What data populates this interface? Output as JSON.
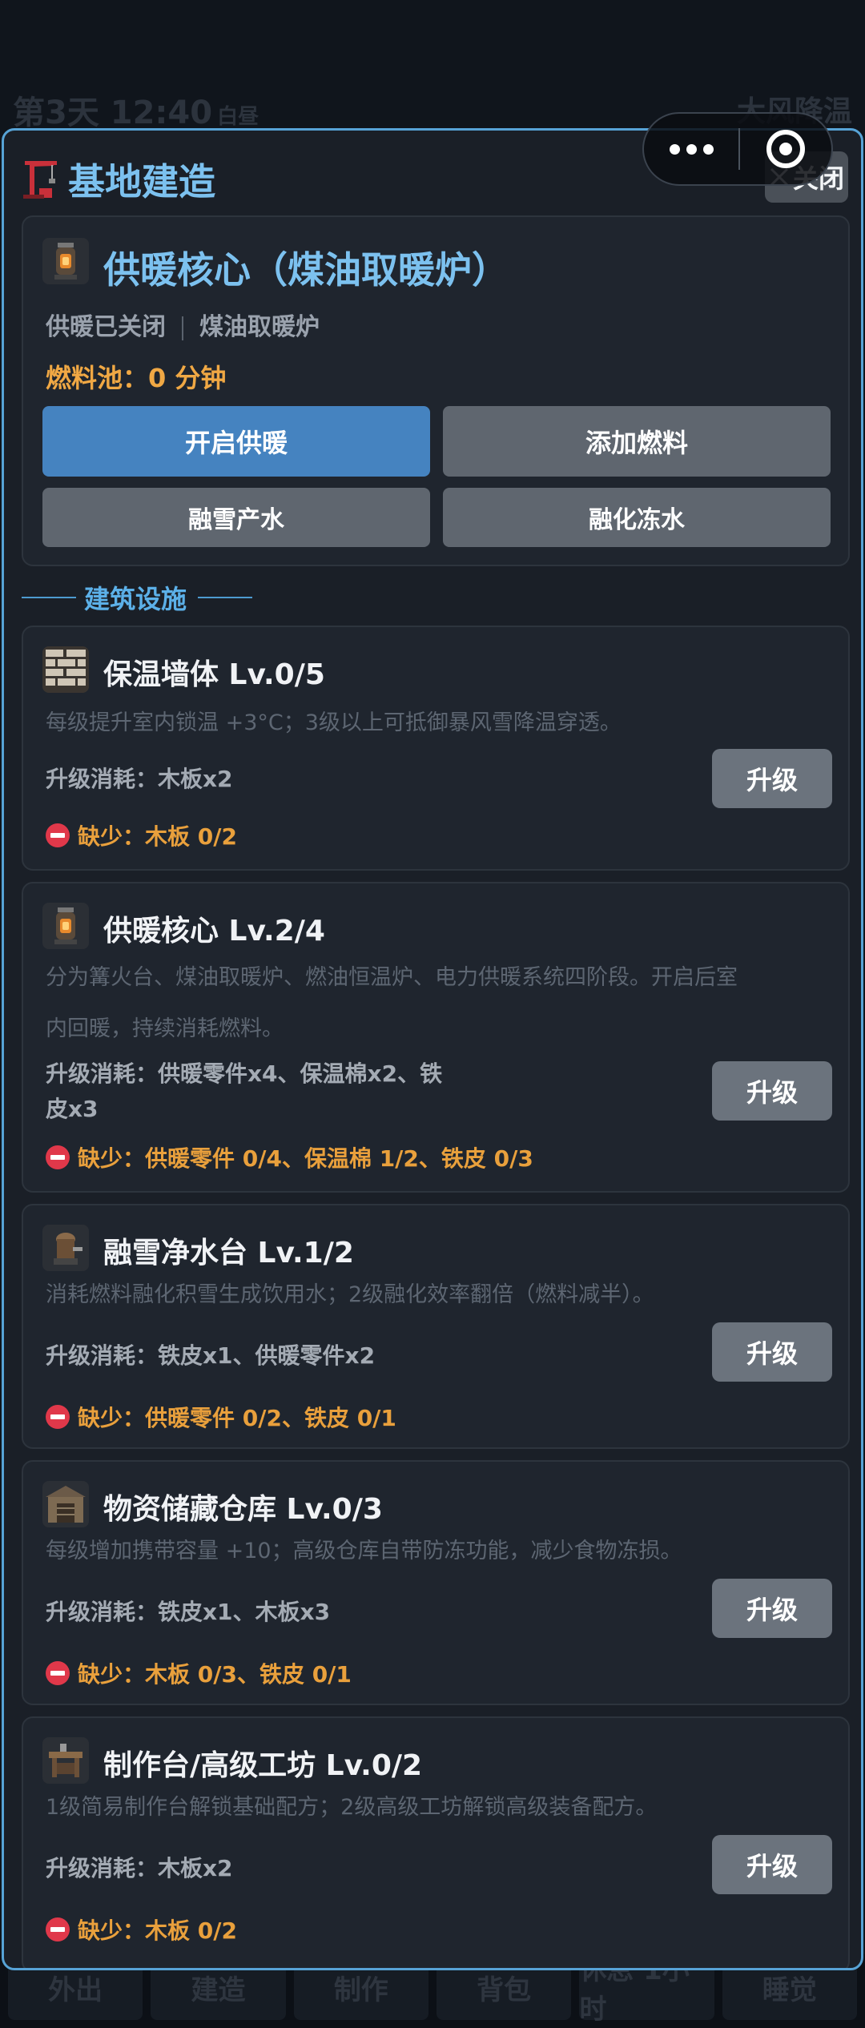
{
  "background": {
    "day_time": "第3天 12:40",
    "period": "白昼",
    "weather": "大风降温",
    "bottom_nav": [
      "外出",
      "建造",
      "制作",
      "背包",
      "休息 1小时",
      "睡觉"
    ]
  },
  "capsule": {
    "menu_icon": "more-dots-icon",
    "close_icon": "target-icon"
  },
  "modal": {
    "title": "基地建造",
    "close_label": "关闭"
  },
  "hero": {
    "title": "供暖核心（煤油取暖炉）",
    "status": "供暖已关闭",
    "stage": "煤油取暖炉",
    "fuel": "燃料池：0 分钟",
    "actions": [
      "开启供暖",
      "添加燃料",
      "融雪产水",
      "融化冻水"
    ]
  },
  "section_title": "建筑设施",
  "buildings": [
    {
      "name": "保温墙体  Lv.0/5",
      "desc": [
        "每级提升室内锁温 +3°C；3级以上可抵御暴风雪降温穿透。"
      ],
      "cost": [
        "升级消耗：木板x2"
      ],
      "lack": "缺少：木板 0/2",
      "button": "升级"
    },
    {
      "name": "供暖核心  Lv.2/4",
      "desc": [
        "分为篝火台、煤油取暖炉、燃油恒温炉、电力供暖系统四阶段。开启后室",
        "内回暖，持续消耗燃料。"
      ],
      "cost": [
        "升级消耗：供暖零件x4、保温棉x2、铁",
        "皮x3"
      ],
      "lack": "缺少：供暖零件 0/4、保温棉 1/2、铁皮 0/3",
      "button": "升级"
    },
    {
      "name": "融雪净水台  Lv.1/2",
      "desc": [
        "消耗燃料融化积雪生成饮用水；2级融化效率翻倍（燃料减半）。"
      ],
      "cost": [
        "升级消耗：铁皮x1、供暖零件x2"
      ],
      "lack": "缺少：供暖零件 0/2、铁皮 0/1",
      "button": "升级"
    },
    {
      "name": "物资储藏仓库  Lv.0/3",
      "desc": [
        "每级增加携带容量 +10；高级仓库自带防冻功能，减少食物冻损。"
      ],
      "cost": [
        "升级消耗：铁皮x1、木板x3"
      ],
      "lack": "缺少：木板 0/3、铁皮 0/1",
      "button": "升级"
    },
    {
      "name": "制作台/高级工坊  Lv.0/2",
      "desc": [
        "1级简易制作台解锁基础配方；2级高级工坊解锁高级装备配方。"
      ],
      "cost": [
        "升级消耗：木板x2"
      ],
      "lack": "缺少：木板 0/2",
      "button": "升级"
    }
  ],
  "colors": {
    "accent": "#7cc1ef",
    "primary_button": "#4583c0",
    "secondary_button": "#5f666f",
    "warning": "#e9a03c",
    "danger": "#e0384a",
    "modal_border": "#57a3d6"
  }
}
